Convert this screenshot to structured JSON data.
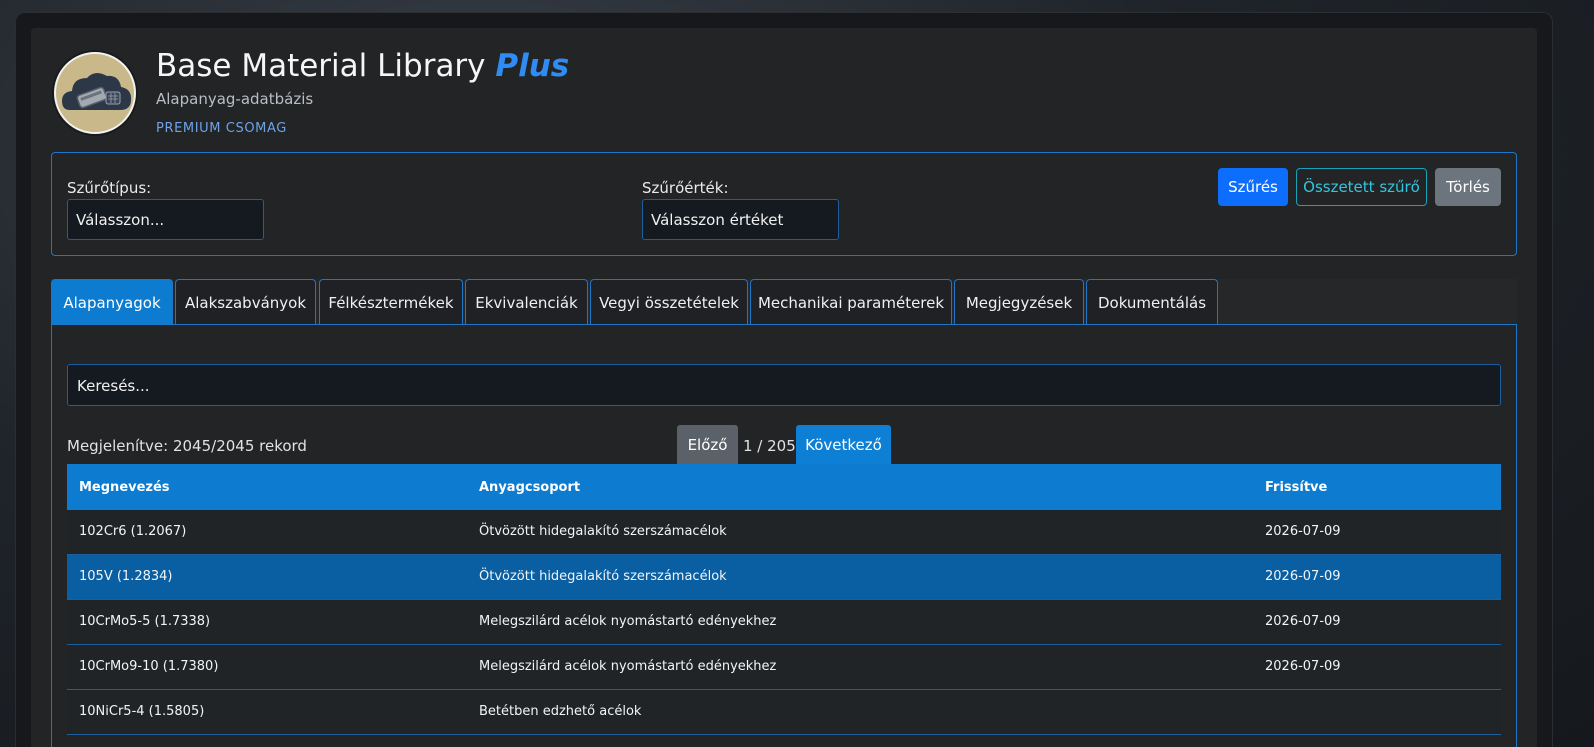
{
  "header": {
    "title_main": "Base Material Library",
    "title_accent": "Plus",
    "subtitle": "Alapanyag-adatbázis",
    "package": "PREMIUM CSOMAG"
  },
  "filter": {
    "type_label": "Szűrőtípus:",
    "type_value": "Válasszon...",
    "value_label": "Szűrőérték:",
    "value_value": "Válasszon értéket",
    "filter_btn": "Szűrés",
    "complex_btn": "Összetett szűrő",
    "clear_btn": "Törlés"
  },
  "tabs": [
    {
      "label": "Alapanyagok"
    },
    {
      "label": "Alakszabványok"
    },
    {
      "label": "Félkésztermékek"
    },
    {
      "label": "Ekvivalenciák"
    },
    {
      "label": "Vegyi összetételek"
    },
    {
      "label": "Mechanikai paraméterek"
    },
    {
      "label": "Megjegyzések"
    },
    {
      "label": "Dokumentálás"
    }
  ],
  "list": {
    "search_placeholder": "Keresés...",
    "count": "Megjelenítve: 2045/2045 rekord",
    "prev": "Előző",
    "page": "1 / 205",
    "next": "Következő"
  },
  "table": {
    "headers": [
      "Megnevezés",
      "Anyagcsoport",
      "Frissítve"
    ],
    "rows": [
      [
        "102Cr6 (1.2067)",
        "Ötvözött hidegalakító szerszámacélok",
        "2026-07-09"
      ],
      [
        "105V (1.2834)",
        "Ötvözött hidegalakító szerszámacélok",
        "2026-07-09"
      ],
      [
        "10CrMo5-5 (1.7338)",
        "Melegszilárd acélok nyomástartó edényekhez",
        "2026-07-09"
      ],
      [
        "10CrMo9-10 (1.7380)",
        "Melegszilárd acélok nyomástartó edényekhez",
        "2026-07-09"
      ],
      [
        "10NiCr5-4 (1.5805)",
        "Betétben edzhető acélok",
        ""
      ]
    ]
  },
  "colors": {
    "accent": "#0c7bd0",
    "plus": "#2f8cf5",
    "border": "#1d76c8"
  }
}
